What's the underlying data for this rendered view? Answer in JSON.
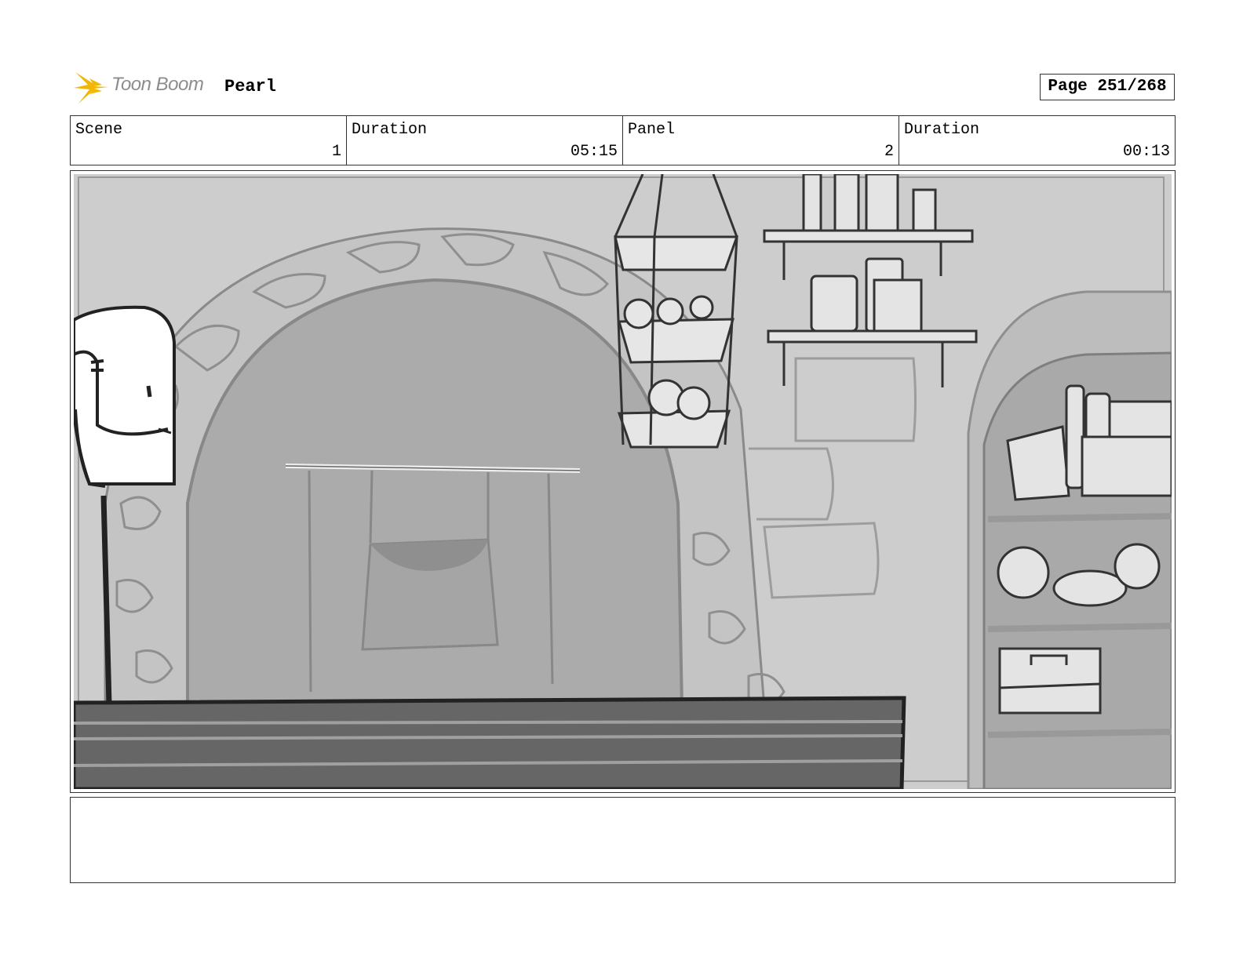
{
  "header": {
    "logo_text": "Toon Boom",
    "project_title": "Pearl",
    "page_label": "Page 251/268"
  },
  "info": {
    "scene_label": "Scene",
    "scene_value": "1",
    "scene_duration_label": "Duration",
    "scene_duration_value": "05:15",
    "panel_label": "Panel",
    "panel_value": "2",
    "panel_duration_label": "Duration",
    "panel_duration_value": "00:13"
  },
  "colors": {
    "logo_yellow": "#f2b705",
    "logo_gray": "#8c8c8c",
    "border": "#333333"
  },
  "caption": {
    "text": ""
  }
}
